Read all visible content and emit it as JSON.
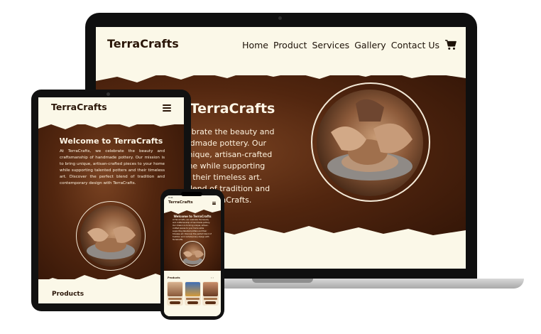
{
  "brand": {
    "name": "TerraCrafts"
  },
  "laptop": {
    "nav": [
      "Home",
      "Product",
      "Services",
      "Gallery",
      "Contact Us"
    ],
    "hero_title": "o TerraCrafts",
    "hero_text_lines": [
      "celebrate the beauty and",
      "handmade pottery. Our",
      "g unique, artisan-crafted",
      "home while supporting",
      "and their timeless art.",
      "ct blend of tradition and",
      "TerraCrafts."
    ]
  },
  "tablet": {
    "title": "Welcome to TerraCrafts",
    "text": "At TerraCrafts, we celebrate the beauty and craftsmanship of handmade pottery. Our mission is to bring unique, artisan-crafted pieces to your home while supporting talented potters and their timeless art. Discover the perfect blend of tradition and contemporary design with TerraCrafts.",
    "products_heading": "Products"
  },
  "phone": {
    "status_time": "9:41",
    "title": "Welcome to TerraCrafts",
    "text": "At TerraCrafts, we celebrate the beauty and craftsmanship of handmade pottery. Our mission is to bring unique, artisan-crafted pieces to your home while supporting talented potters and their timeless art. Discover the perfect blend of tradition and contemporary design with TerraCrafts.",
    "products_heading": "Products",
    "carousel_arrows": "‹ ›"
  },
  "colors": {
    "cream": "#fbf8e8",
    "dark_brown": "#2f1306",
    "mid_brown": "#7a4322",
    "text_dark": "#2a1608"
  },
  "icons": [
    "cart-icon",
    "hamburger-icon"
  ]
}
